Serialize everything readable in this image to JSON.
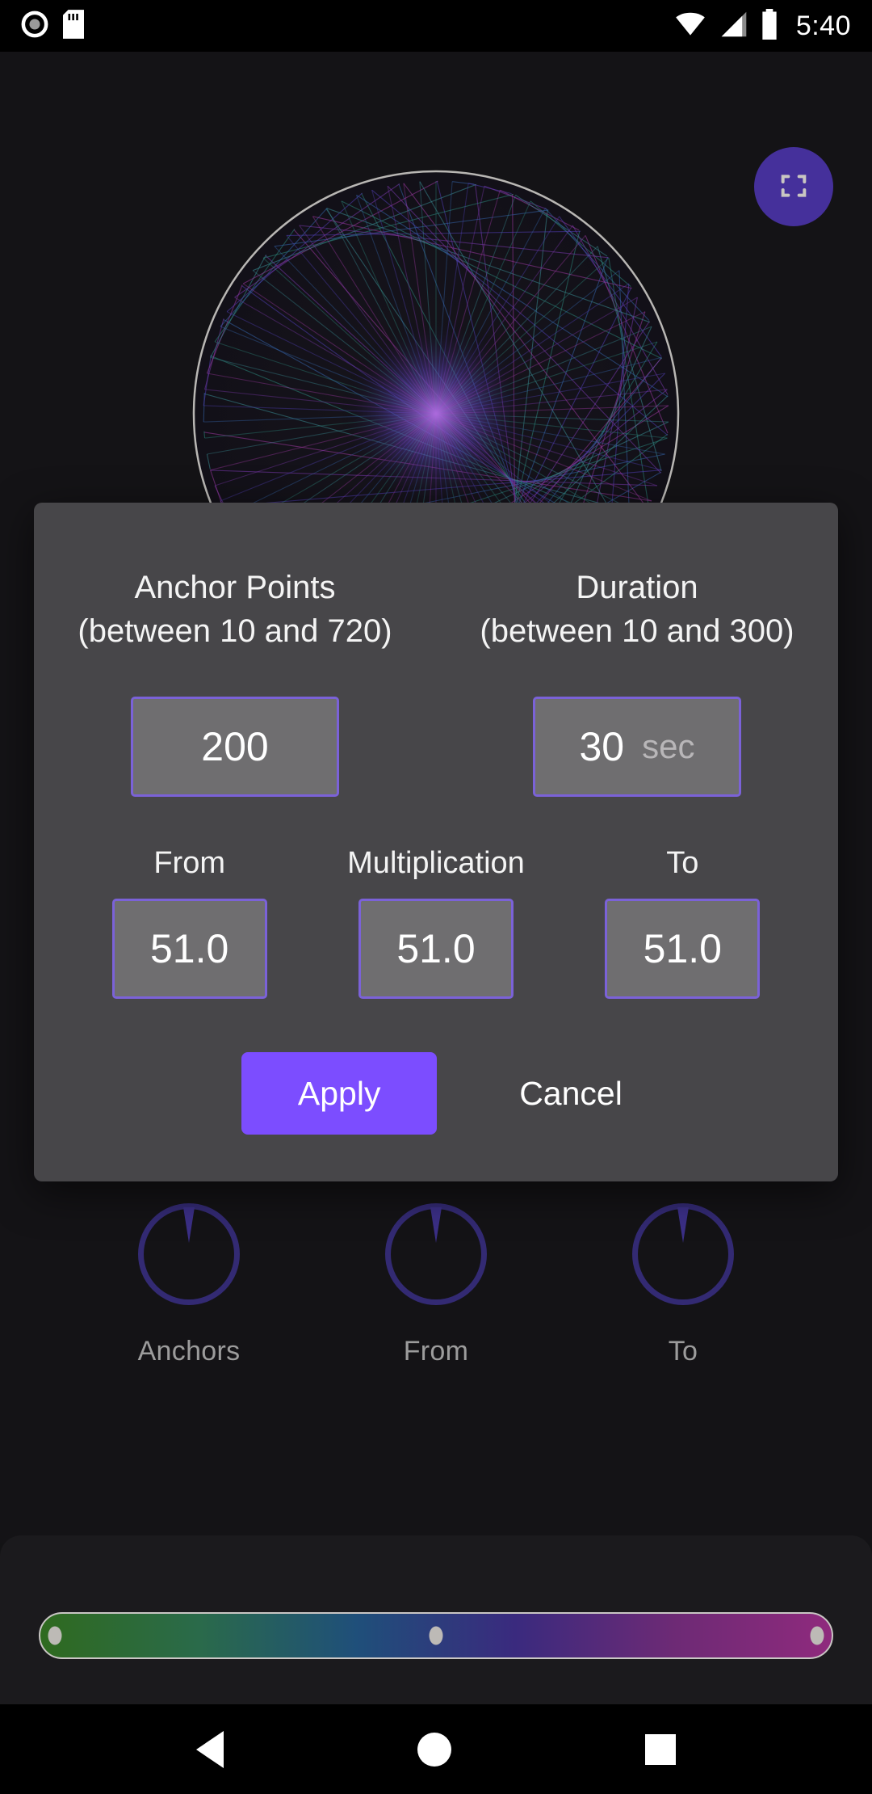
{
  "status_bar": {
    "time": "5:40",
    "icons": [
      "record-icon",
      "sd-card-icon",
      "wifi-icon",
      "signal-icon",
      "battery-icon"
    ]
  },
  "canvas": {
    "fullscreen_button_label": "fullscreen-icon",
    "accent": "#45309b"
  },
  "knobs": [
    {
      "label": "Anchors"
    },
    {
      "label": "From"
    },
    {
      "label": "To"
    }
  ],
  "slider": {
    "gradient_stops": [
      "#2f6a1f",
      "#2a6a4a",
      "#1f4f7a",
      "#3a2a7e",
      "#6d2a75",
      "#8f2a7d"
    ],
    "handle_positions": [
      1,
      50,
      99
    ]
  },
  "dialog": {
    "anchor_points": {
      "title": "Anchor Points",
      "range": "(between 10 and 720)",
      "value": "200"
    },
    "duration": {
      "title": "Duration",
      "range": "(between 10 and 300)",
      "value": "30",
      "unit": "sec"
    },
    "from": {
      "label": "From",
      "value": "51.0"
    },
    "multiplication": {
      "label": "Multiplication",
      "value": "51.0"
    },
    "to": {
      "label": "To",
      "value": "51.0"
    },
    "apply_label": "Apply",
    "cancel_label": "Cancel",
    "accent": "#7c4dff",
    "field_border": "#7b62d8",
    "background": "#474649"
  },
  "navigation": {
    "back": "back-triangle-icon",
    "home": "home-circle-icon",
    "recents": "recents-square-icon"
  }
}
